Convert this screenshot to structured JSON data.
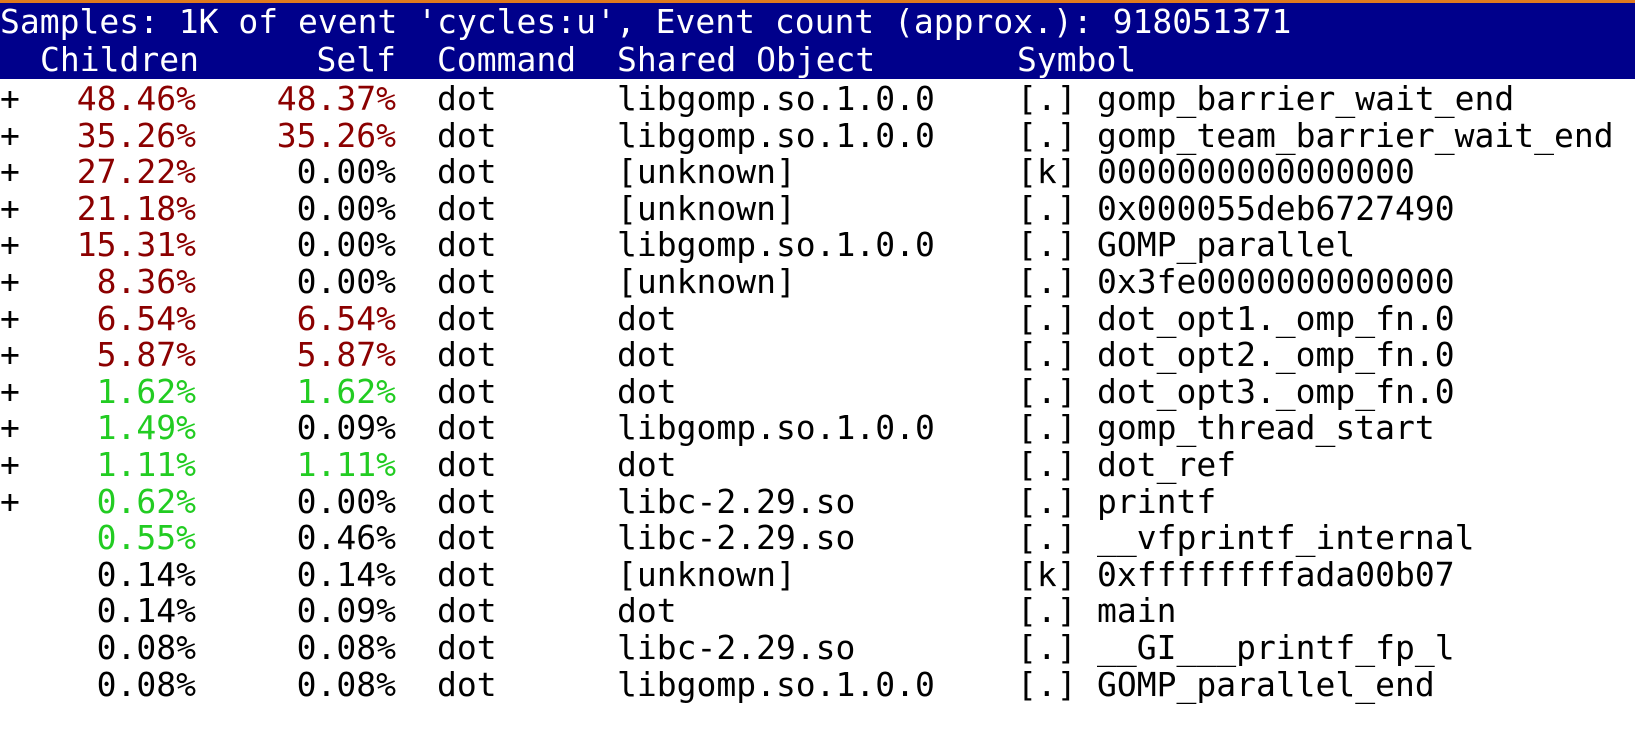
{
  "header": {
    "summary": "Samples: 1K of event 'cycles:u', Event count (approx.): 918051371",
    "columns": {
      "children": "Children",
      "self": "Self",
      "command": "Command",
      "shared_object": "Shared Object",
      "symbol": "Symbol"
    }
  },
  "colors": {
    "header_bg": "#00008b",
    "hot": "#8b0000",
    "warm": "#22cc22",
    "accent_line": "#e07a1e"
  },
  "rows": [
    {
      "expand": "+",
      "children": "48.46%",
      "self": "48.37%",
      "command": "dot",
      "shared_object": "libgomp.so.1.0.0",
      "level": "[.]",
      "symbol": "gomp_barrier_wait_end",
      "children_heat": "hot",
      "self_heat": "hot"
    },
    {
      "expand": "+",
      "children": "35.26%",
      "self": "35.26%",
      "command": "dot",
      "shared_object": "libgomp.so.1.0.0",
      "level": "[.]",
      "symbol": "gomp_team_barrier_wait_end",
      "children_heat": "hot",
      "self_heat": "hot"
    },
    {
      "expand": "+",
      "children": "27.22%",
      "self": "0.00%",
      "command": "dot",
      "shared_object": "[unknown]",
      "level": "[k]",
      "symbol": "0000000000000000",
      "children_heat": "hot",
      "self_heat": "cold"
    },
    {
      "expand": "+",
      "children": "21.18%",
      "self": "0.00%",
      "command": "dot",
      "shared_object": "[unknown]",
      "level": "[.]",
      "symbol": "0x000055deb6727490",
      "children_heat": "hot",
      "self_heat": "cold"
    },
    {
      "expand": "+",
      "children": "15.31%",
      "self": "0.00%",
      "command": "dot",
      "shared_object": "libgomp.so.1.0.0",
      "level": "[.]",
      "symbol": "GOMP_parallel",
      "children_heat": "hot",
      "self_heat": "cold"
    },
    {
      "expand": "+",
      "children": "8.36%",
      "self": "0.00%",
      "command": "dot",
      "shared_object": "[unknown]",
      "level": "[.]",
      "symbol": "0x3fe0000000000000",
      "children_heat": "hot",
      "self_heat": "cold"
    },
    {
      "expand": "+",
      "children": "6.54%",
      "self": "6.54%",
      "command": "dot",
      "shared_object": "dot",
      "level": "[.]",
      "symbol": "dot_opt1._omp_fn.0",
      "children_heat": "hot",
      "self_heat": "hot"
    },
    {
      "expand": "+",
      "children": "5.87%",
      "self": "5.87%",
      "command": "dot",
      "shared_object": "dot",
      "level": "[.]",
      "symbol": "dot_opt2._omp_fn.0",
      "children_heat": "hot",
      "self_heat": "hot"
    },
    {
      "expand": "+",
      "children": "1.62%",
      "self": "1.62%",
      "command": "dot",
      "shared_object": "dot",
      "level": "[.]",
      "symbol": "dot_opt3._omp_fn.0",
      "children_heat": "warm",
      "self_heat": "warm"
    },
    {
      "expand": "+",
      "children": "1.49%",
      "self": "0.09%",
      "command": "dot",
      "shared_object": "libgomp.so.1.0.0",
      "level": "[.]",
      "symbol": "gomp_thread_start",
      "children_heat": "warm",
      "self_heat": "cold"
    },
    {
      "expand": "+",
      "children": "1.11%",
      "self": "1.11%",
      "command": "dot",
      "shared_object": "dot",
      "level": "[.]",
      "symbol": "dot_ref",
      "children_heat": "warm",
      "self_heat": "warm"
    },
    {
      "expand": "+",
      "children": "0.62%",
      "self": "0.00%",
      "command": "dot",
      "shared_object": "libc-2.29.so",
      "level": "[.]",
      "symbol": "printf",
      "children_heat": "warm",
      "self_heat": "cold"
    },
    {
      "expand": "",
      "children": "0.55%",
      "self": "0.46%",
      "command": "dot",
      "shared_object": "libc-2.29.so",
      "level": "[.]",
      "symbol": "__vfprintf_internal",
      "children_heat": "warm",
      "self_heat": "cold"
    },
    {
      "expand": "",
      "children": "0.14%",
      "self": "0.14%",
      "command": "dot",
      "shared_object": "[unknown]",
      "level": "[k]",
      "symbol": "0xffffffffada00b07",
      "children_heat": "cold",
      "self_heat": "cold"
    },
    {
      "expand": "",
      "children": "0.14%",
      "self": "0.09%",
      "command": "dot",
      "shared_object": "dot",
      "level": "[.]",
      "symbol": "main",
      "children_heat": "cold",
      "self_heat": "cold"
    },
    {
      "expand": "",
      "children": "0.08%",
      "self": "0.08%",
      "command": "dot",
      "shared_object": "libc-2.29.so",
      "level": "[.]",
      "symbol": "__GI___printf_fp_l",
      "children_heat": "cold",
      "self_heat": "cold"
    },
    {
      "expand": "",
      "children": "0.08%",
      "self": "0.08%",
      "command": "dot",
      "shared_object": "libgomp.so.1.0.0",
      "level": "[.]",
      "symbol": "GOMP_parallel_end",
      "children_heat": "cold",
      "self_heat": "cold"
    }
  ]
}
